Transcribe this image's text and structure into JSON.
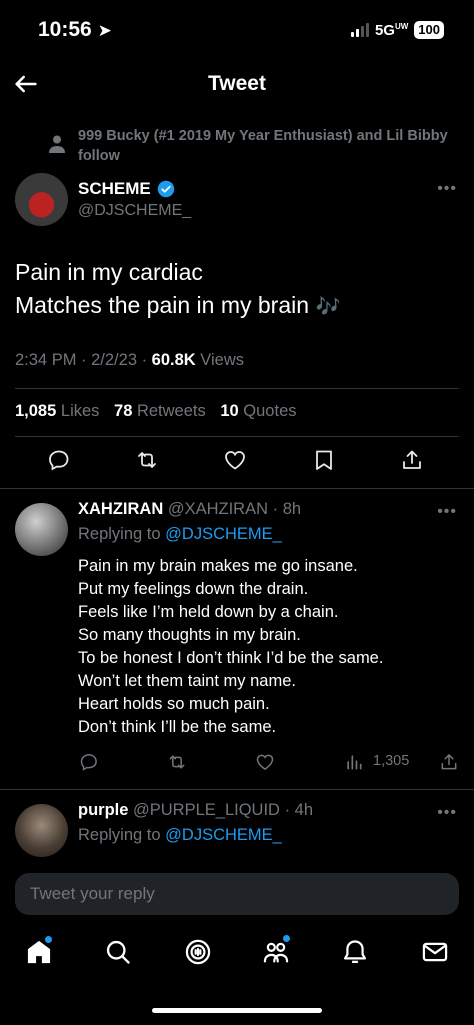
{
  "status_bar": {
    "time": "10:56",
    "network": "5G",
    "network_sub": "UW",
    "battery": "100"
  },
  "header": {
    "title": "Tweet"
  },
  "social_context": "999 Bucky (#1 2019 My Year Enthusiast) and Lil Bibby follow",
  "tweet": {
    "author_name": "SCHEME",
    "author_handle": "@DJSCHEME_",
    "text_line1": "Pain in my cardiac",
    "text_line2": "Matches the pain in my brain",
    "emoji": "🎶",
    "time": "2:34 PM",
    "date": "2/2/23",
    "views_count": "60.8K",
    "views_label": "Views",
    "likes_count": "1,085",
    "likes_label": "Likes",
    "retweets_count": "78",
    "retweets_label": "Retweets",
    "quotes_count": "10",
    "quotes_label": "Quotes"
  },
  "replies": [
    {
      "name": "XAHZIRAN",
      "handle": "@XAHZIRAN",
      "age": "8h",
      "replying_to_label": "Replying to",
      "replying_to": "@DJSCHEME_",
      "lines": [
        "Pain in my brain makes me go insane.",
        "Put my feelings down the drain.",
        "Feels like I’m held down by a chain.",
        "So many thoughts in my brain.",
        "To be honest I don’t think I’d be the same.",
        "Won’t let them taint my name.",
        "Heart holds so much pain.",
        "Don’t think I’ll be the same."
      ],
      "views": "1,305"
    },
    {
      "name": "purple",
      "handle": "@PURPLE_LIQUID",
      "age": "4h",
      "replying_to_label": "Replying to",
      "replying_to": "@DJSCHEME_"
    }
  ],
  "compose": {
    "placeholder": "Tweet your reply"
  },
  "colors": {
    "accent": "#1d9bf0",
    "muted": "#71767b",
    "background": "#000000"
  }
}
